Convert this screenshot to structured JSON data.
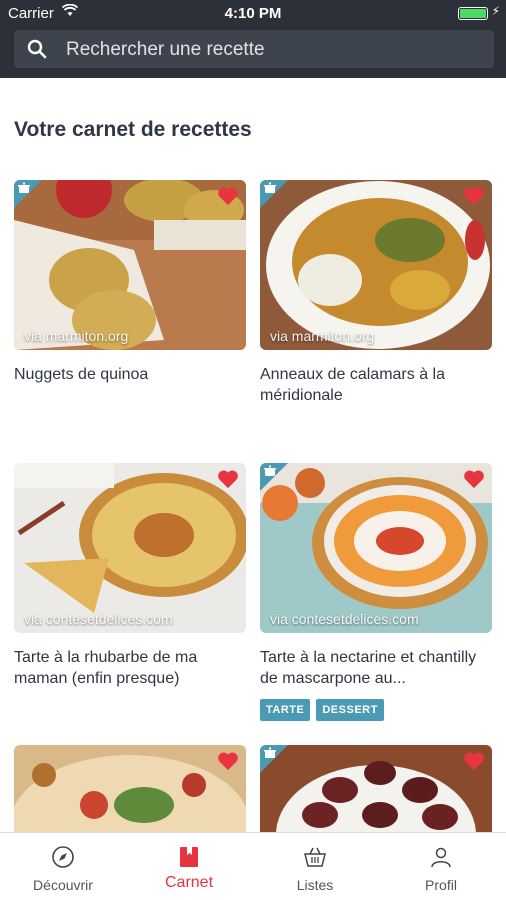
{
  "status": {
    "carrier": "Carrier",
    "time": "4:10 PM"
  },
  "search": {
    "placeholder": "Rechercher une recette"
  },
  "section_title": "Votre carnet de recettes",
  "cards": [
    {
      "title": "Nuggets de quinoa",
      "source": "via marmiton.org",
      "favorite": true
    },
    {
      "title": "Anneaux de calamars à la méridionale",
      "source": "via marmiton.org",
      "favorite": true
    },
    {
      "title": "Tarte à la rhubarbe de ma maman (enfin presque)",
      "source": "via contesetdelices.com",
      "favorite": true
    },
    {
      "title": "Tarte à la nectarine et chantilly de mascarpone au...",
      "source": "via contesetdelices.com",
      "favorite": true,
      "tags": [
        "TARTE",
        "DESSERT"
      ]
    },
    {
      "title": "",
      "source": "",
      "favorite": true
    },
    {
      "title": "",
      "source": "",
      "favorite": true
    }
  ],
  "tabs": [
    {
      "label": "Découvrir",
      "icon": "compass-icon"
    },
    {
      "label": "Carnet",
      "icon": "book-icon",
      "active": true
    },
    {
      "label": "Listes",
      "icon": "basket-icon"
    },
    {
      "label": "Profil",
      "icon": "person-icon"
    }
  ],
  "colors": {
    "accent": "#e8343f",
    "tag": "#4b9ab3",
    "header": "#2c3038"
  }
}
